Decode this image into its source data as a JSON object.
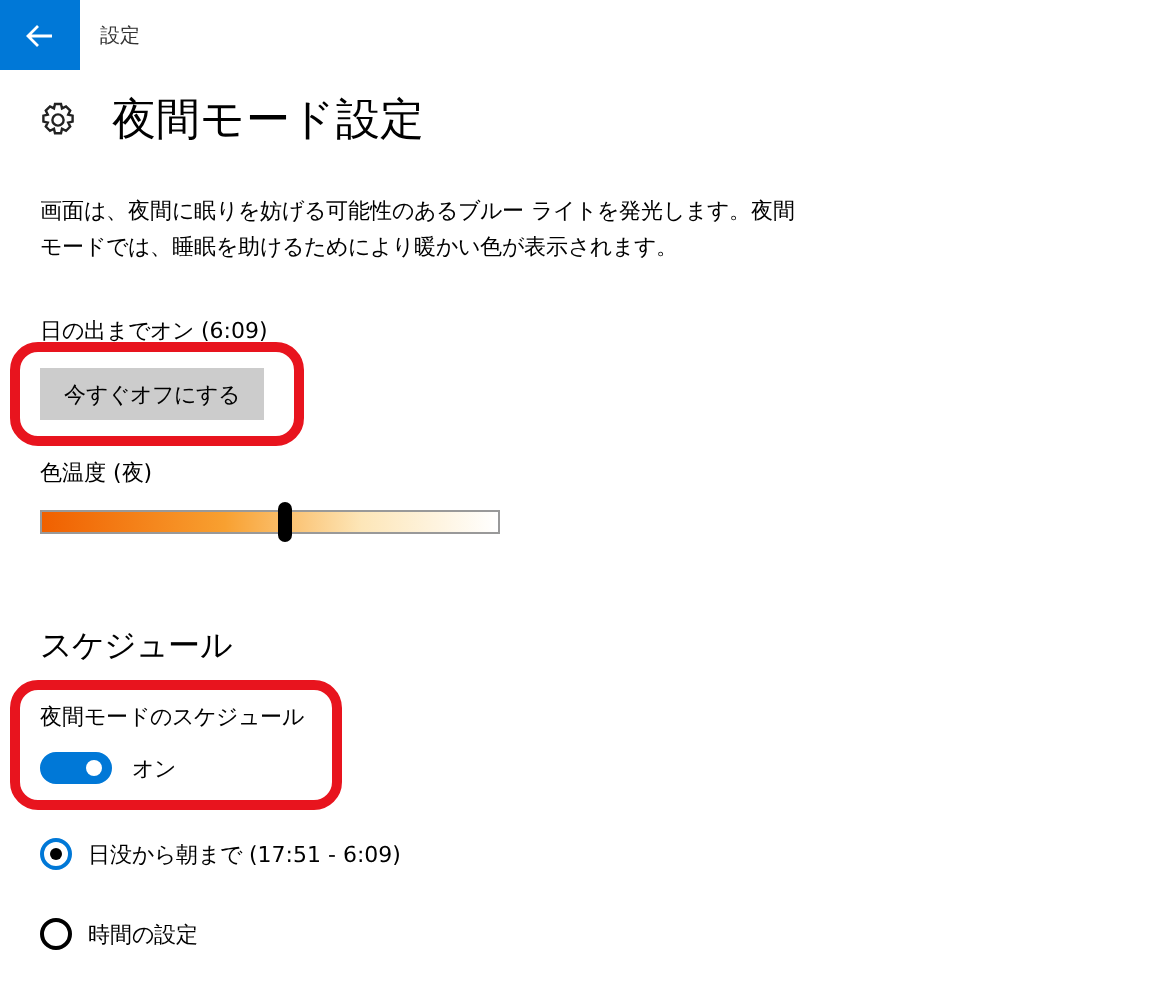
{
  "header": {
    "title": "設定"
  },
  "page": {
    "title": "夜間モード設定",
    "description": "画面は、夜間に眠りを妨げる可能性のあるブルー ライトを発光します。夜間モードでは、睡眠を助けるためにより暖かい色が表示されます。"
  },
  "status": "日の出までオン (6:09)",
  "turn_off_button": {
    "label": "今すぐオフにする",
    "highlighted": true
  },
  "color_temperature": {
    "label": "色温度 (夜)",
    "level": 0.53
  },
  "schedule": {
    "heading": "スケジュール",
    "toggle_label": "夜間モードのスケジュール",
    "on": true,
    "state_text": "オン",
    "highlighted": true,
    "options": [
      {
        "label": "日没から朝まで (17:51 - 6:09)",
        "selected": true
      },
      {
        "label": "時間の設定",
        "selected": false
      }
    ]
  }
}
